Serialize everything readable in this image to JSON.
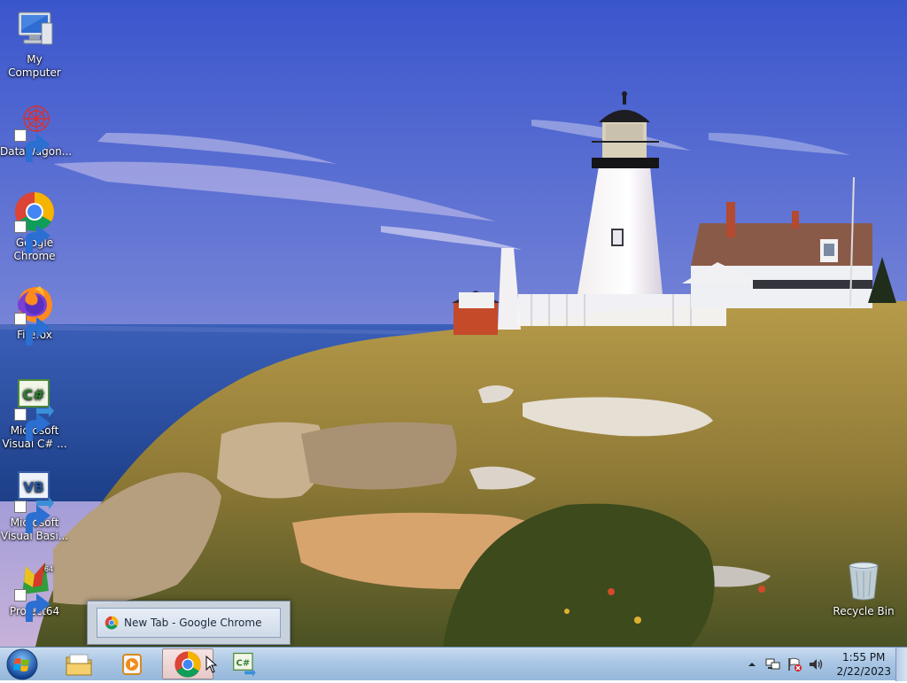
{
  "desktop": {
    "icons": [
      {
        "label": "My Computer",
        "icon": "my-computer-icon",
        "shortcut": false
      },
      {
        "label": "DataWagon...",
        "icon": "datawagon-icon",
        "shortcut": true
      },
      {
        "label": "Google Chrome",
        "icon": "chrome-icon",
        "shortcut": true
      },
      {
        "label": "Firefox",
        "icon": "firefox-icon",
        "shortcut": true
      },
      {
        "label": "Microsoft Visual C# ...",
        "icon": "visual-csharp-icon",
        "shortcut": true
      },
      {
        "label": "Microsoft Visual Basi...",
        "icon": "visual-basic-icon",
        "shortcut": true
      },
      {
        "label": "Project64",
        "icon": "project64-icon",
        "shortcut": true
      }
    ],
    "recycle_bin": {
      "label": "Recycle Bin",
      "icon": "recycle-bin-icon"
    }
  },
  "taskbar_thumbnail": {
    "title": "New Tab - Google Chrome",
    "icon": "chrome-icon"
  },
  "taskbar": {
    "start_icon": "windows-start-icon",
    "pinned": [
      {
        "name": "file-explorer",
        "icon": "folder-icon",
        "active": false
      },
      {
        "name": "media-player",
        "icon": "media-player-icon",
        "active": false
      },
      {
        "name": "google-chrome",
        "icon": "chrome-icon",
        "active": true
      },
      {
        "name": "visual-csharp",
        "icon": "visual-csharp-icon",
        "active": false
      }
    ],
    "tray": {
      "icons": [
        "show-hidden-icons-icon",
        "network-icon",
        "action-center-flag-icon",
        "volume-icon"
      ],
      "time": "1:55 PM",
      "date": "2/22/2023"
    }
  },
  "colors": {
    "sky_top": "#3f5fd0",
    "sky_bottom": "#b9a9d8",
    "sea": "#2b4fa0",
    "grass": "#a98d3e",
    "taskbar": "#aac6e4"
  }
}
